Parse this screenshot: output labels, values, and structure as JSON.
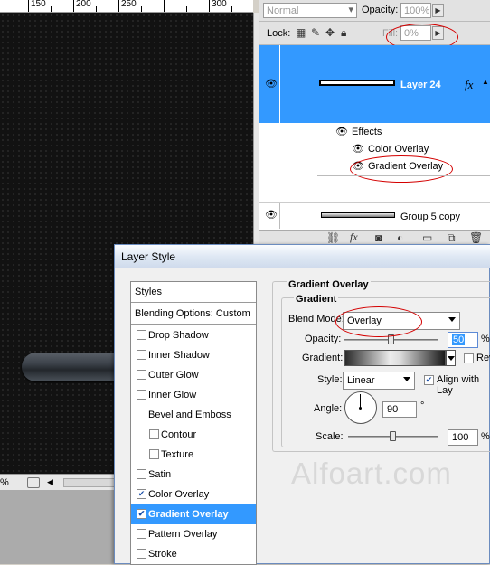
{
  "ruler": {
    "marks": [
      "150",
      "200",
      "250",
      "300"
    ]
  },
  "status": {
    "zoom": "%",
    "arrow": "◀"
  },
  "layers_panel": {
    "blend_mode": "Normal",
    "opacity_label": "Opacity:",
    "opacity_value": "100%",
    "lock_label": "Lock:",
    "fill_label": "Fill:",
    "fill_value": "0%",
    "layers": [
      {
        "name": "Layer 24",
        "fx": "fx"
      },
      {
        "name": "Group 5 copy"
      }
    ],
    "effects_label": "Effects",
    "effects": [
      "Color Overlay",
      "Gradient Overlay"
    ]
  },
  "dialog": {
    "title": "Layer Style",
    "styles_header": "Styles",
    "blending": "Blending Options: Custom",
    "items": [
      {
        "label": "Drop Shadow",
        "checked": false,
        "indent": false
      },
      {
        "label": "Inner Shadow",
        "checked": false,
        "indent": false
      },
      {
        "label": "Outer Glow",
        "checked": false,
        "indent": false
      },
      {
        "label": "Inner Glow",
        "checked": false,
        "indent": false
      },
      {
        "label": "Bevel and Emboss",
        "checked": false,
        "indent": false
      },
      {
        "label": "Contour",
        "checked": false,
        "indent": true
      },
      {
        "label": "Texture",
        "checked": false,
        "indent": true
      },
      {
        "label": "Satin",
        "checked": false,
        "indent": false
      },
      {
        "label": "Color Overlay",
        "checked": true,
        "indent": false
      },
      {
        "label": "Gradient Overlay",
        "checked": true,
        "indent": false,
        "selected": true
      },
      {
        "label": "Pattern Overlay",
        "checked": false,
        "indent": false
      },
      {
        "label": "Stroke",
        "checked": false,
        "indent": false
      }
    ],
    "section_title": "Gradient Overlay",
    "group_title": "Gradient",
    "blend_mode_label": "Blend Mode:",
    "blend_mode_value": "Overlay",
    "opacity_label": "Opacity:",
    "opacity_value": "50",
    "opacity_unit": "%",
    "opacity_level": 0.5,
    "gradient_label": "Gradient:",
    "reverse_label": "Rev",
    "style_label": "Style:",
    "style_value": "Linear",
    "align_label": "Align with Lay",
    "angle_label": "Angle:",
    "angle_value": "90",
    "angle_unit": "°",
    "scale_label": "Scale:",
    "scale_value": "100",
    "scale_unit": "%",
    "scale_level": 0.5
  },
  "watermark": "Alfoart.com",
  "colors": {
    "highlight": "#3399ff",
    "annotation": "#d40000"
  }
}
